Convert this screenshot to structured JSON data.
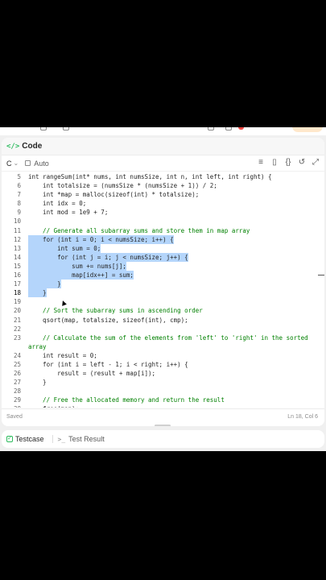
{
  "panel": {
    "title": "Code",
    "icon": "code-icon"
  },
  "toolbar": {
    "language": "C",
    "mode": "Auto"
  },
  "editor": {
    "lines": [
      {
        "n": "5",
        "text": "int rangeSum(int* nums, int numsSize, int n, int left, int right) {"
      },
      {
        "n": "6",
        "text": "    int totalsize = (numsSize * (numsSize + 1)) / 2;"
      },
      {
        "n": "7",
        "text": "    int *map = malloc(sizeof(int) * totalsize);"
      },
      {
        "n": "8",
        "text": "    int idx = 0;"
      },
      {
        "n": "9",
        "text": "    int mod = 1e9 + 7;"
      },
      {
        "n": "10",
        "text": ""
      },
      {
        "n": "11",
        "text": "    // Generate all subarray sums and store them in map array"
      },
      {
        "n": "12",
        "text": "    for (int i = 0; i < numsSize; i++) {"
      },
      {
        "n": "13",
        "text": "        int sum = 0;"
      },
      {
        "n": "14",
        "text": "        for (int j = i; j < numsSize; j++) {"
      },
      {
        "n": "15",
        "text": "            sum += nums[j];"
      },
      {
        "n": "16",
        "text": "            map[idx++] = sum;"
      },
      {
        "n": "17",
        "text": "        }"
      },
      {
        "n": "18",
        "text": "    }"
      },
      {
        "n": "19",
        "text": ""
      },
      {
        "n": "20",
        "text": "    // Sort the subarray sums in ascending order"
      },
      {
        "n": "21",
        "text": "    qsort(map, totalsize, sizeof(int), cmp);"
      },
      {
        "n": "22",
        "text": ""
      },
      {
        "n": "23",
        "text": "    // Calculate the sum of the elements from 'left' to 'right' in the sorted"
      },
      {
        "n": "",
        "text": "array"
      },
      {
        "n": "24",
        "text": "    int result = 0;"
      },
      {
        "n": "25",
        "text": "    for (int i = left - 1; i < right; i++) {"
      },
      {
        "n": "26",
        "text": "        result = (result + map[i]);"
      },
      {
        "n": "27",
        "text": "    }"
      },
      {
        "n": "28",
        "text": ""
      },
      {
        "n": "29",
        "text": "    // Free the allocated memory and return the result"
      },
      {
        "n": "30",
        "text": "    free(map);"
      }
    ]
  },
  "status": {
    "saved": "Saved",
    "position": "Ln 18, Col 6"
  },
  "tabs": [
    {
      "label": "Testcase",
      "icon": "check-icon"
    },
    {
      "label": "Test Result",
      "icon": "terminal-icon"
    }
  ],
  "colors": {
    "accent": "#2cbb5d",
    "selection": "#b4d5fb",
    "comment": "#008000"
  }
}
